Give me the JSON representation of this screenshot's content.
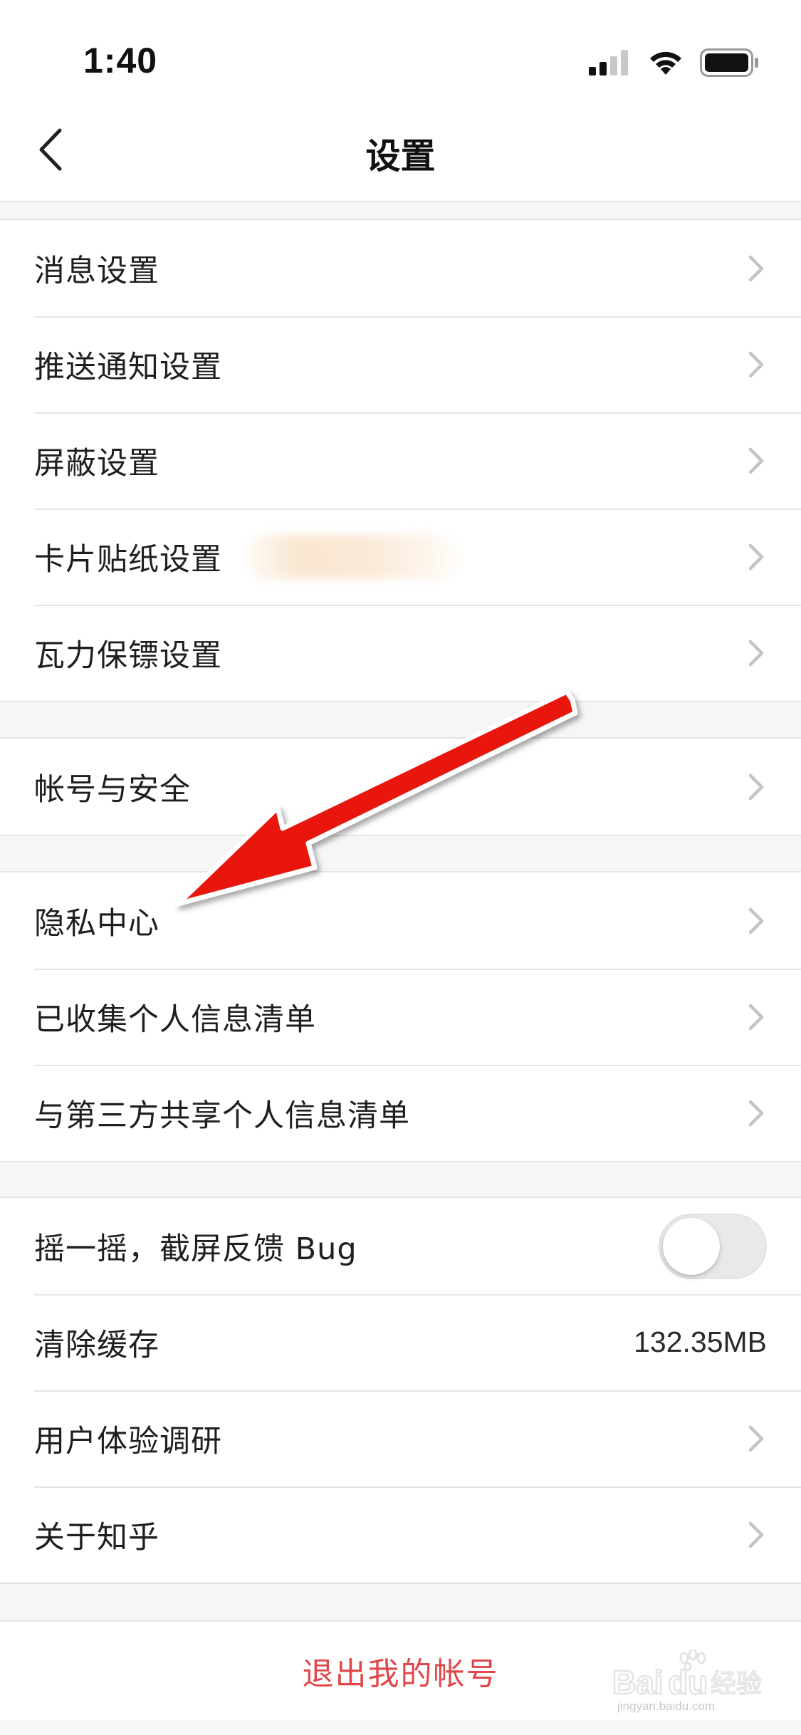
{
  "status_bar": {
    "time": "1:40"
  },
  "nav": {
    "title": "设置"
  },
  "groups": {
    "general": {
      "items": [
        {
          "label": "消息设置"
        },
        {
          "label": "推送通知设置"
        },
        {
          "label": "屏蔽设置"
        },
        {
          "label": "卡片贴纸设置"
        },
        {
          "label": "瓦力保镖设置"
        }
      ]
    },
    "account": {
      "items": [
        {
          "label": "帐号与安全"
        }
      ]
    },
    "privacy": {
      "items": [
        {
          "label": "隐私中心"
        },
        {
          "label": "已收集个人信息清单"
        },
        {
          "label": "与第三方共享个人信息清单"
        }
      ]
    },
    "misc": {
      "shake_feedback": {
        "label": "摇一摇，截屏反馈 Bug",
        "enabled": false
      },
      "clear_cache": {
        "label": "清除缓存",
        "value": "132.35MB"
      },
      "survey": {
        "label": "用户体验调研"
      },
      "about": {
        "label": "关于知乎"
      }
    }
  },
  "logout": {
    "label": "退出我的帐号"
  },
  "colors": {
    "accent_red": "#e0474a",
    "arrow_red": "#e8120c",
    "background": "#f6f6f6"
  },
  "watermark": {
    "brand": "Baidu经验",
    "url": "jingyan.baidu.com"
  }
}
